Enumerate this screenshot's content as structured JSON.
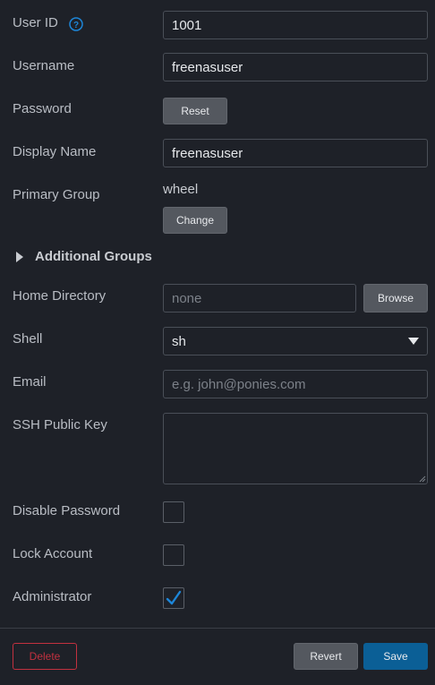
{
  "form": {
    "user_id": {
      "label": "User ID",
      "value": "1001"
    },
    "username": {
      "label": "Username",
      "value": "freenasuser"
    },
    "password": {
      "label": "Password",
      "button": "Reset"
    },
    "display_name": {
      "label": "Display Name",
      "value": "freenasuser"
    },
    "primary_group": {
      "label": "Primary Group",
      "value": "wheel",
      "button": "Change"
    },
    "additional_groups": {
      "label": "Additional Groups"
    },
    "home_directory": {
      "label": "Home Directory",
      "placeholder": "none",
      "button": "Browse"
    },
    "shell": {
      "label": "Shell",
      "value": "sh"
    },
    "email": {
      "label": "Email",
      "placeholder": "e.g. john@ponies.com"
    },
    "ssh_public_key": {
      "label": "SSH Public Key",
      "value": ""
    },
    "disable_password": {
      "label": "Disable Password",
      "checked": false
    },
    "lock_account": {
      "label": "Lock Account",
      "checked": false
    },
    "administrator": {
      "label": "Administrator",
      "checked": true
    }
  },
  "footer": {
    "delete_label": "Delete",
    "revert_label": "Revert",
    "save_label": "Save"
  },
  "icons": {
    "help": "help-icon",
    "expand": "caret-right-icon",
    "dropdown": "caret-down-icon",
    "check": "checkmark-icon"
  },
  "colors": {
    "background": "#1e2128",
    "accent": "#1d86d8",
    "save": "#0b5f96",
    "danger": "#c2313f"
  }
}
